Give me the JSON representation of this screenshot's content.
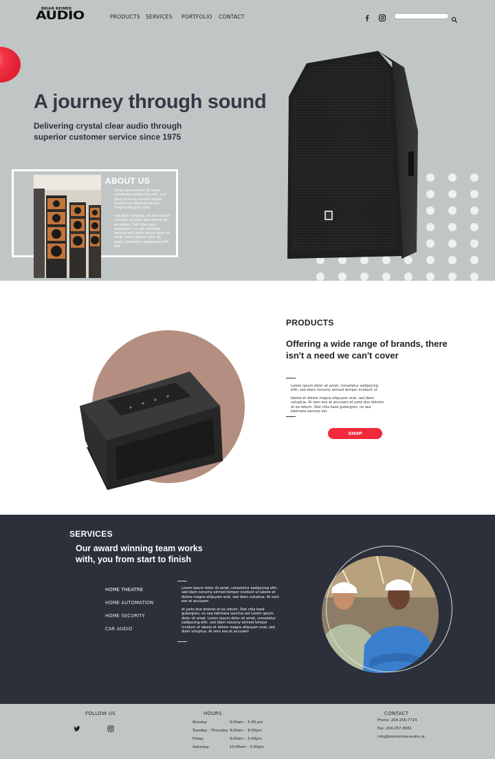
{
  "brand": {
    "logo_small": "BRIAN REIMER",
    "logo_big": "AUDIO"
  },
  "nav": {
    "items": [
      "PRODUCTS",
      "SERVICES",
      "PORTFOLIO",
      "CONTACT"
    ],
    "search_placeholder": ""
  },
  "hero": {
    "title": "A journey through sound",
    "subtitle": "Delivering crystal clear audio through superior customer service since 1975"
  },
  "about": {
    "title": "ABOUT US",
    "text1": "Lorem ipsum dolor sit amet, consetetur sadipscing elitr, sed diam nonumy eirmod tempor invidunt ut labore et dolore magna aliquyam erat.",
    "text2": "sed diam voluptua. At vero eos et accusam et justo duo dolores et ea rebum. Stet clita kasd gubergren, no sea takimata sanctus est Lorem ipsum dolor sit amet. Lorem ipsum dolor sit amet, consetetur sadipscing elitr, sed"
  },
  "products": {
    "label": "PRODUCTS",
    "heading": "Offering a wide range of brands, there isn't a need we can't cover",
    "text1": "Lorem ipsum dolor sit amet, consetetur sadipscing elitr, sed diam nonumy eirmod tempor invidunt ut",
    "text2": "labore et dolore magna aliquyam erat, sed diam voluptua. At vero eos et accusam et justo duo dolores et ea rebum. Stet clita kasd gubergren, no sea takimata sanctus est",
    "shop_label": "SHOP"
  },
  "services": {
    "title": "SERVICES",
    "heading": "Our award winning team works with, you from start to finish",
    "items": [
      "HOME THEATRE",
      "HOME AUTOMATION",
      "HOME SECURITY",
      "CAR AUDIO"
    ],
    "text1": "Lorem ipsum dolor sit amet, consetetur sadipscing elitr, sed diam nonumy eirmod tempor invidunt ut labore et dolore magna aliquyam erat, sed diam voluptua. At vero eos et accusam",
    "text2": "et justo duo dolores et ea rebum. Stet clita kasd gubergren, no sea takimata sanctus est Lorem ipsum dolor sit amet. Lorem ipsum dolor sit amet, consetetur sadipscing elitr, sed diam nonumy eirmod tempor invidunt ut labore et dolore magna aliquyam erat, sed diam voluptua. At vero eos et accusam"
  },
  "footer": {
    "follow_title": "FOLLOW US",
    "hours_title": "HOURS",
    "hours": [
      {
        "day": "Monday",
        "time": "9:00am – 5:00 pm"
      },
      {
        "day": "Tuesday - Thursday",
        "time": "9:00am – 8:00pm"
      },
      {
        "day": "Friday",
        "time": "9:00am – 5:00pm"
      },
      {
        "day": "Saturday",
        "time": "10:00am – 5:00pm"
      }
    ],
    "contact_title": "CONTACT",
    "phone": "Phone: 204-256-7724",
    "fax": "Fax: 204-257-8581",
    "email": "info@brianreimeraudio.ca"
  },
  "icons": {
    "facebook": "facebook-icon",
    "instagram": "instagram-icon",
    "twitter": "twitter-icon",
    "search": "search-icon"
  },
  "colors": {
    "hero_bg": "#c0c6c6",
    "accent_red": "#f2293a",
    "services_bg": "#2b303b",
    "product_circle": "#b48e80"
  }
}
